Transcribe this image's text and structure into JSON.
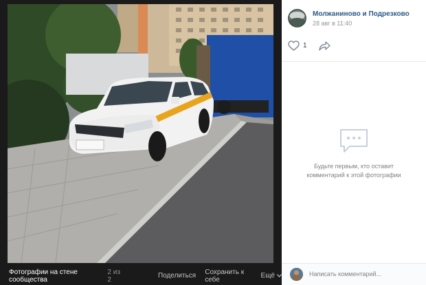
{
  "viewer": {
    "album_label": "Фотографии на стене сообщества",
    "counter": "2 из 2",
    "share_label": "Поделиться",
    "save_label": "Сохранить к себе",
    "more_label": "Ещё",
    "photo_plate_text": "..."
  },
  "post": {
    "group_name": "Молжаниново и Подрезково",
    "date": "28 авг в 11:40",
    "like_count": "1"
  },
  "comments": {
    "empty_text": "Будьте первым, кто оставит комментарий к этой фотографии",
    "input_placeholder": "Написать комментарий..."
  },
  "icons": {
    "like": "heart-icon",
    "share": "share-arrow-icon",
    "empty": "chat-bubble-icon",
    "more": "chevron-down-icon"
  },
  "colors": {
    "link": "#2a5885",
    "muted": "#939393",
    "viewer_bg": "#1a1a1a",
    "taxi_stripe": "#e8a41c"
  }
}
